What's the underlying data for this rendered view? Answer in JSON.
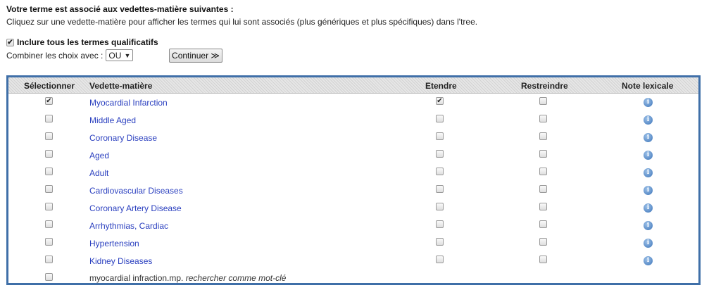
{
  "header": {
    "title": "Votre terme est associé aux vedettes-matière suivantes :",
    "subtitle": "Cliquez sur une vedette-matière pour afficher les termes qui lui sont associés (plus génériques et plus spécifiques) dans l'tree."
  },
  "options": {
    "include_label": "Inclure tous les termes qualificatifs",
    "include_checked": true,
    "combine_label": "Combiner les choix avec :",
    "combine_value": "OU",
    "continue_label": "Continuer ≫"
  },
  "table": {
    "columns": [
      "Sélectionner",
      "Vedette-matière",
      "Etendre",
      "Restreindre",
      "Note lexicale"
    ],
    "rows": [
      {
        "term": "Myocardial Infarction",
        "selected": true,
        "expand": true,
        "restrict": false
      },
      {
        "term": "Middle Aged",
        "selected": false,
        "expand": false,
        "restrict": false
      },
      {
        "term": "Coronary Disease",
        "selected": false,
        "expand": false,
        "restrict": false
      },
      {
        "term": "Aged",
        "selected": false,
        "expand": false,
        "restrict": false
      },
      {
        "term": "Adult",
        "selected": false,
        "expand": false,
        "restrict": false
      },
      {
        "term": "Cardiovascular Diseases",
        "selected": false,
        "expand": false,
        "restrict": false
      },
      {
        "term": "Coronary Artery Disease",
        "selected": false,
        "expand": false,
        "restrict": false
      },
      {
        "term": "Arrhythmias, Cardiac",
        "selected": false,
        "expand": false,
        "restrict": false
      },
      {
        "term": "Hypertension",
        "selected": false,
        "expand": false,
        "restrict": false
      },
      {
        "term": "Kidney Diseases",
        "selected": false,
        "expand": false,
        "restrict": false
      }
    ],
    "keyword_row": {
      "query": "myocardial infraction.mp.",
      "label": "rechercher comme mot-clé",
      "selected": false
    },
    "info_icon": "info-icon"
  },
  "colors": {
    "frame": "#3f6fa8",
    "link": "#2a3fbf",
    "info": "#3b73b8"
  }
}
